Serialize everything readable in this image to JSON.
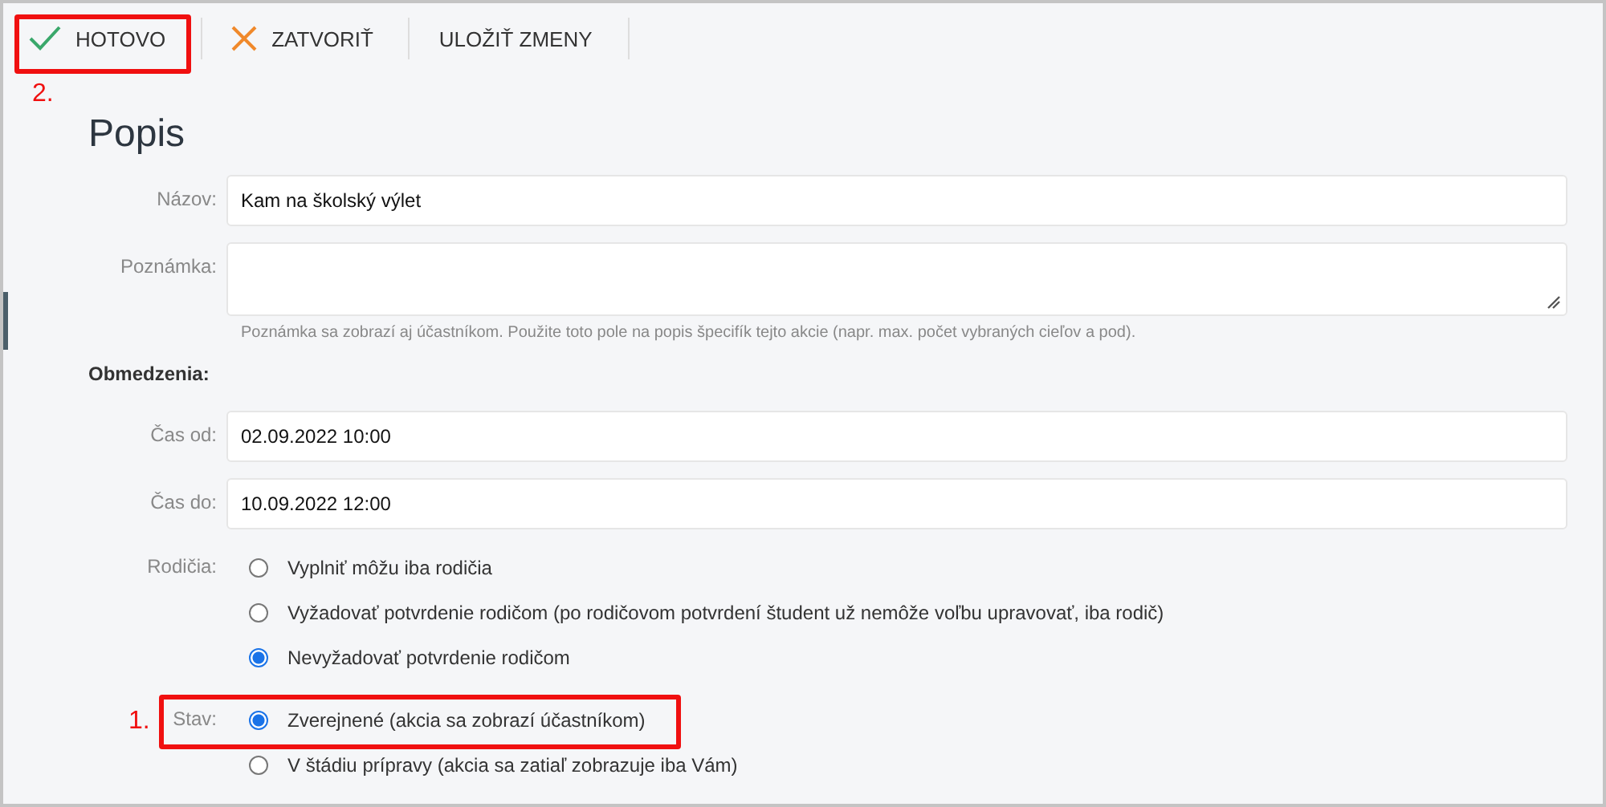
{
  "toolbar": {
    "buttons": [
      {
        "label": "HOTOVO",
        "kind": "check",
        "annotation": "2."
      },
      {
        "label": "ZATVORIŤ",
        "kind": "cross"
      },
      {
        "label": "ULOŽIŤ ZMENY",
        "kind": "plain"
      }
    ]
  },
  "heading": "Popis",
  "fields": [
    {
      "label": "Názov:",
      "kind": "input",
      "value": "Kam na školský výlet"
    },
    {
      "label": "Poznámka:",
      "kind": "textarea",
      "hint": "Poznámka sa zobrazí aj účastníkom. Použite toto pole na popis špecifík tejto akcie (napr. max. počet vybraných cieľov a pod)."
    }
  ],
  "section_title": "Obmedzenia:",
  "limits": [
    {
      "label": "Čas od:",
      "kind": "input",
      "value": "02.09.2022 10:00"
    },
    {
      "label": "Čas do:",
      "kind": "input",
      "value": "10.09.2022 12:00"
    }
  ],
  "parents": {
    "label": "Rodičia:",
    "options": [
      {
        "label": "Vyplniť môžu iba rodičia",
        "selected": false
      },
      {
        "label": "Vyžadovať potvrdenie rodičom (po rodičovom potvrdení študent už nemôže voľbu upravovať, iba rodič)",
        "selected": false
      },
      {
        "label": "Nevyžadovať potvrdenie rodičom",
        "selected": true
      }
    ]
  },
  "status": {
    "label": "Stav:",
    "annotation": "1.",
    "options": [
      {
        "label": "Zverejnené (akcia sa zobrazí účastníkom)",
        "selected": true
      },
      {
        "label": "V štádiu prípravy (akcia sa zatiaľ zobrazuje iba Vám)",
        "selected": false
      }
    ]
  }
}
